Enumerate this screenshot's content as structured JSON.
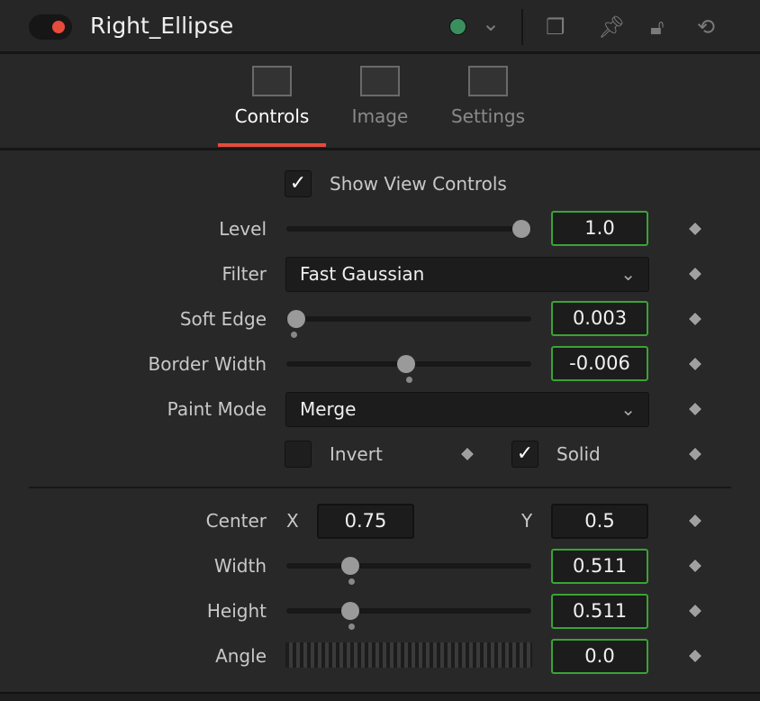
{
  "header": {
    "title": "Right_Ellipse",
    "color": "#3a8f5e"
  },
  "tabs": [
    {
      "label": "Controls"
    },
    {
      "label": "Image"
    },
    {
      "label": "Settings"
    }
  ],
  "show_view_controls": {
    "label": "Show View Controls",
    "checked": true
  },
  "level": {
    "label": "Level",
    "value": "1.0",
    "slider": 0.96
  },
  "filter": {
    "label": "Filter",
    "value": "Fast Gaussian"
  },
  "soft_edge": {
    "label": "Soft Edge",
    "value": "0.003",
    "slider": 0.04
  },
  "border_width": {
    "label": "Border Width",
    "value": "-0.006",
    "slider": 0.49
  },
  "paint_mode": {
    "label": "Paint Mode",
    "value": "Merge"
  },
  "invert": {
    "label": "Invert",
    "checked": false
  },
  "solid": {
    "label": "Solid",
    "checked": true
  },
  "center": {
    "label": "Center",
    "x_label": "X",
    "x": "0.75",
    "y_label": "Y",
    "y": "0.5"
  },
  "width": {
    "label": "Width",
    "value": "0.511",
    "slider": 0.26
  },
  "height": {
    "label": "Height",
    "value": "0.511",
    "slider": 0.26
  },
  "angle": {
    "label": "Angle",
    "value": "0.0"
  },
  "icons": {
    "check": "✓",
    "chevron": "⌄"
  }
}
